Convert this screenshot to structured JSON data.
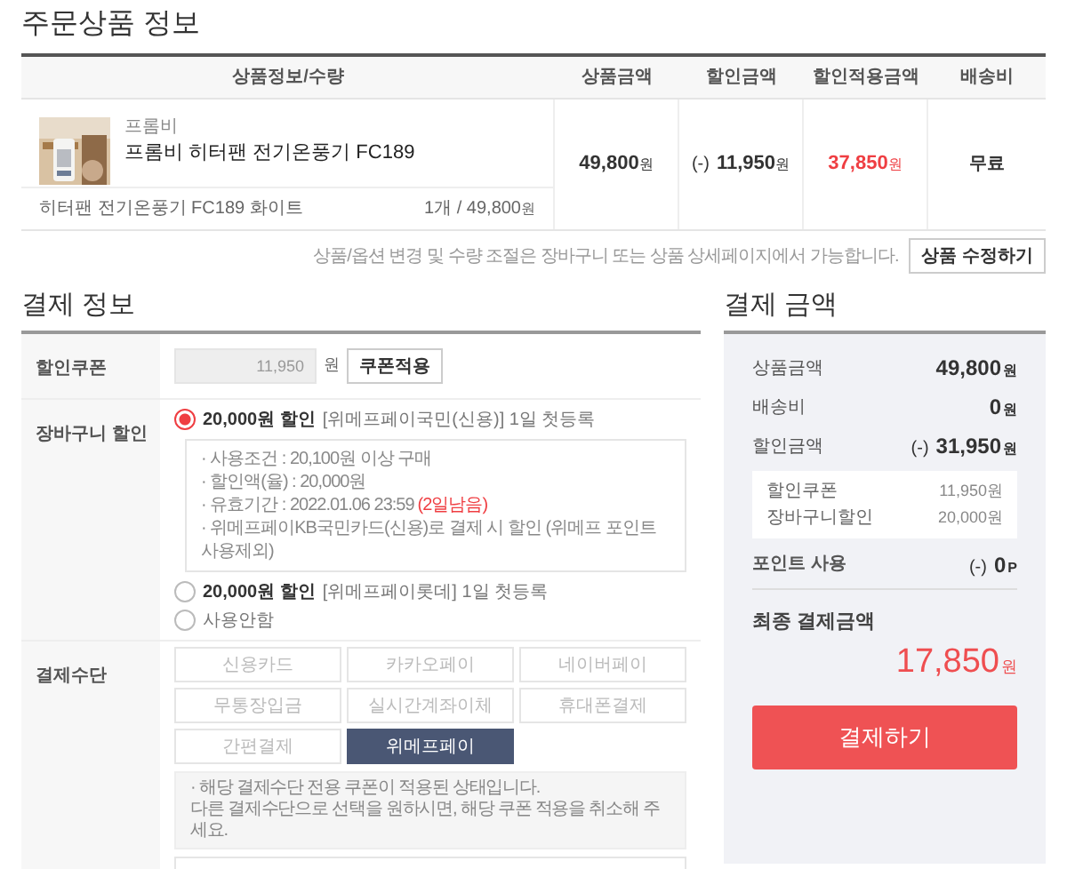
{
  "order_section": {
    "title": "주문상품 정보",
    "columns": [
      "상품정보/수량",
      "상품금액",
      "할인금액",
      "할인적용금액",
      "배송비"
    ],
    "rows": [
      {
        "brand": "프롬비",
        "name": "프롬비 히터팬 전기온풍기 FC189",
        "option": "히터팬 전기온풍기 FC189 화이트",
        "quantity_price": {
          "text": "1개 / 49,800",
          "unit": "원"
        },
        "price": {
          "amount": "49,800",
          "unit": "원"
        },
        "discount": {
          "prefix": "(-)",
          "amount": "11,950",
          "unit": "원"
        },
        "discounted_price": {
          "amount": "37,850",
          "unit": "원"
        },
        "shipping": "무료"
      }
    ],
    "note": "상품/옵션 변경 및 수량 조절은 장바구니 또는 상품 상세페이지에서 가능합니다.",
    "edit_button": "상품 수정하기"
  },
  "payment_info": {
    "title": "결제 정보",
    "coupon": {
      "label": "할인쿠폰",
      "value": "11,950",
      "disabled": true,
      "unit": "원",
      "button": "쿠폰적용"
    },
    "cart_discount": {
      "label": "장바구니 할인",
      "options": [
        {
          "amount": "20,000원 할인",
          "detail": "[위메프페이국민(신용)] 1일 첫등록",
          "selected": true,
          "conditions": [
            {
              "text": "· 사용조건 : 20,100원 이상 구매"
            },
            {
              "text": "· 할인액(율) : 20,000원"
            },
            {
              "text": "· 유효기간 : 2022.01.06 23:59",
              "remaining": "(2일남음)"
            },
            {
              "text": "· 위메프페이KB국민카드(신용)로 결제 시 할인 (위메프 포인트 사용제외)"
            }
          ]
        },
        {
          "amount": "20,000원 할인",
          "detail": "[위메프페이롯데] 1일 첫등록",
          "selected": false
        },
        {
          "detail": "사용안함",
          "selected": false
        }
      ]
    },
    "payment_method": {
      "label": "결제수단",
      "methods": [
        {
          "label": "신용카드",
          "selected": false
        },
        {
          "label": "카카오페이",
          "selected": false
        },
        {
          "label": "네이버페이",
          "selected": false
        },
        {
          "label": "무통장입금",
          "selected": false
        },
        {
          "label": "실시간계좌이체",
          "selected": false
        },
        {
          "label": "휴대폰결제",
          "selected": false
        },
        {
          "label": "간편결제",
          "selected": false
        },
        {
          "label": "위메프페이",
          "selected": true
        }
      ],
      "notice": [
        "· 해당 결제수단 전용 쿠폰이 적용된 상태입니다.",
        "다른 결제수단으로 선택을 원하시면, 해당 쿠폰 적용을 취소해 주세요."
      ]
    }
  },
  "payment_amount": {
    "title": "결제 금액",
    "rows": [
      {
        "label": "상품금액",
        "amount": "49,800",
        "unit": "원"
      },
      {
        "label": "배송비",
        "amount": "0",
        "unit": "원"
      },
      {
        "label": "할인금액",
        "prefix": "(-)",
        "amount": "31,950",
        "unit": "원"
      }
    ],
    "discount_details": [
      {
        "label": "할인쿠폰",
        "value": "11,950원"
      },
      {
        "label": "장바구니할인",
        "value": "20,000원"
      }
    ],
    "points": {
      "label": "포인트 사용",
      "prefix": "(-)",
      "amount": "0",
      "unit": "P"
    },
    "total": {
      "label": "최종 결제금액",
      "amount": "17,850",
      "unit": "원"
    },
    "pay_button": "결제하기"
  }
}
